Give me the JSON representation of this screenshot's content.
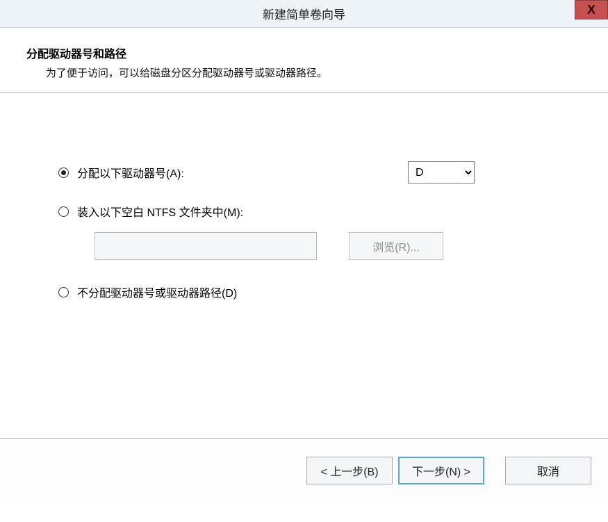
{
  "titlebar": {
    "title": "新建简单卷向导",
    "close": "X"
  },
  "header": {
    "heading": "分配驱动器号和路径",
    "sub": "为了便于访问，可以给磁盘分区分配驱动器号或驱动器路径。"
  },
  "options": {
    "assign_label": "分配以下驱动器号(A):",
    "drive_selected": "D",
    "mount_label": "装入以下空白 NTFS 文件夹中(M):",
    "mount_value": "",
    "browse_label": "浏览(R)...",
    "noassign_label": "不分配驱动器号或驱动器路径(D)"
  },
  "footer": {
    "back": "< 上一步(B)",
    "next": "下一步(N) >",
    "cancel": "取消"
  }
}
